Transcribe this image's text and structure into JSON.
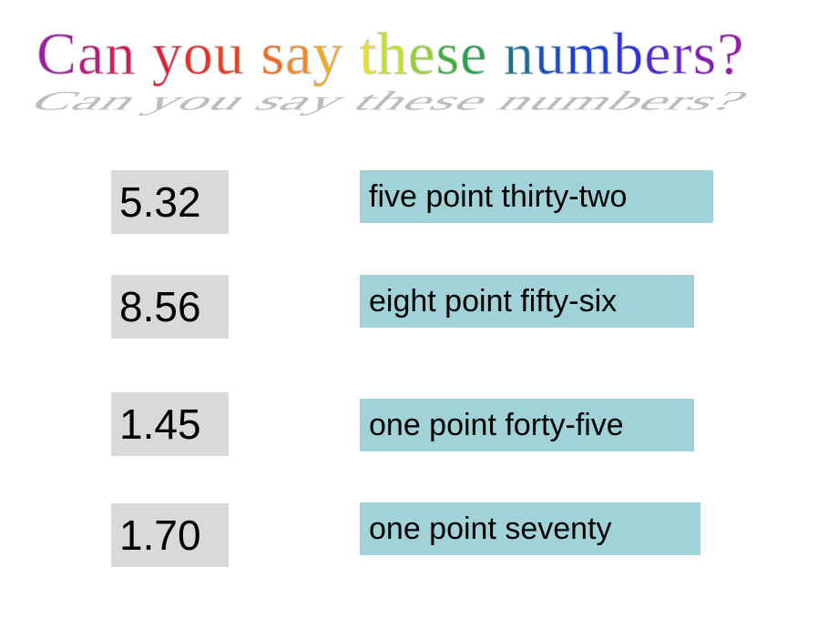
{
  "title": {
    "words": [
      "Can",
      "you",
      "say",
      "these",
      "numbers?"
    ],
    "letter_colors": [
      "#9b1fa0",
      "#c01880",
      "#d81a5a",
      "#e0203a",
      "#e83028",
      "#e84022",
      "#f06a20",
      "#f48a20",
      "#f4a820",
      "#e8e020",
      "#c8e020",
      "#98d030",
      "#40b040",
      "#2aa050",
      "#1a7090",
      "#1850c0",
      "#1a40d8",
      "#3030e0",
      "#5028d8",
      "#7020c8",
      "#8a1ab8",
      "#9a18a8",
      "#a818a0"
    ]
  },
  "rows": [
    {
      "number": "5.32",
      "words": "five point thirty-two"
    },
    {
      "number": "8.56",
      "words": "eight point fifty-six"
    },
    {
      "number": "1.45",
      "words": "one point forty-five"
    },
    {
      "number": "1.70",
      "words": "one point seventy"
    }
  ],
  "colors": {
    "number_box": "#d9d9d9",
    "word_box": "#a0d2d8"
  }
}
